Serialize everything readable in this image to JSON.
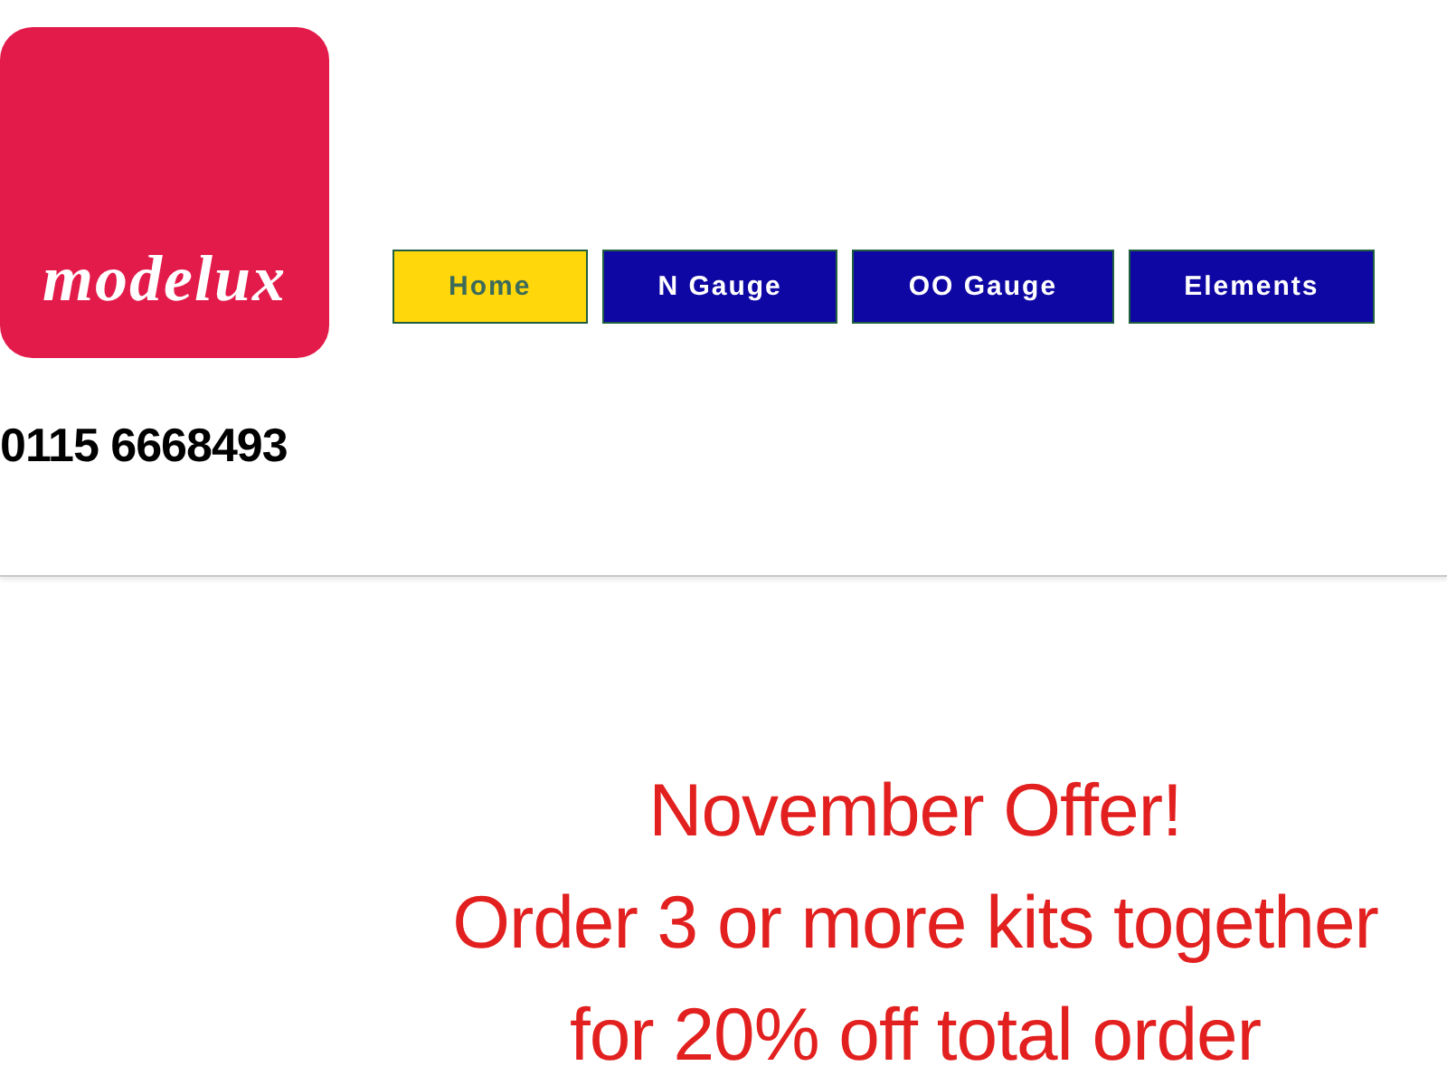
{
  "logo": {
    "text": "modelux"
  },
  "nav": [
    {
      "label": "Home",
      "selected": true
    },
    {
      "label": "N Gauge",
      "selected": false
    },
    {
      "label": "OO Gauge",
      "selected": false
    },
    {
      "label": "Elements",
      "selected": false
    }
  ],
  "phone": "0115 6668493",
  "offer": {
    "lines": [
      "November Offer!",
      "Order 3 or more kits together",
      "for 20% off total order"
    ]
  }
}
